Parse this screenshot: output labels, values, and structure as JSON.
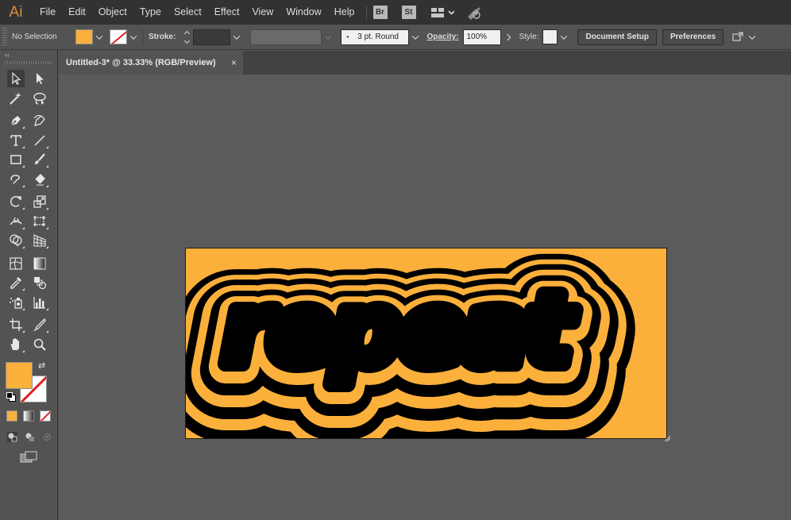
{
  "app": {
    "logo": "Ai",
    "menu": [
      "File",
      "Edit",
      "Object",
      "Type",
      "Select",
      "Effect",
      "View",
      "Window",
      "Help"
    ],
    "badges": [
      "Br",
      "St"
    ]
  },
  "control_bar": {
    "selection": "No Selection",
    "stroke_label": "Stroke:",
    "brush_label": "3 pt. Round",
    "opacity_label": "Opacity:",
    "opacity_value": "100%",
    "style_label": "Style:",
    "document_setup": "Document Setup",
    "preferences": "Preferences",
    "fill_color": "#fbb03b"
  },
  "document": {
    "tab_title": "Untitled-3* @ 33.33% (RGB/Preview)",
    "close_glyph": "×"
  },
  "artwork": {
    "text": "repeat",
    "colors": {
      "primary": "#fbb03b",
      "secondary": "#000000"
    }
  },
  "toolbox": {
    "fill_color": "#fbb03b",
    "stroke_color": "none",
    "toggle_glyph": "⇄",
    "collapse_glyph": "‹‹"
  }
}
